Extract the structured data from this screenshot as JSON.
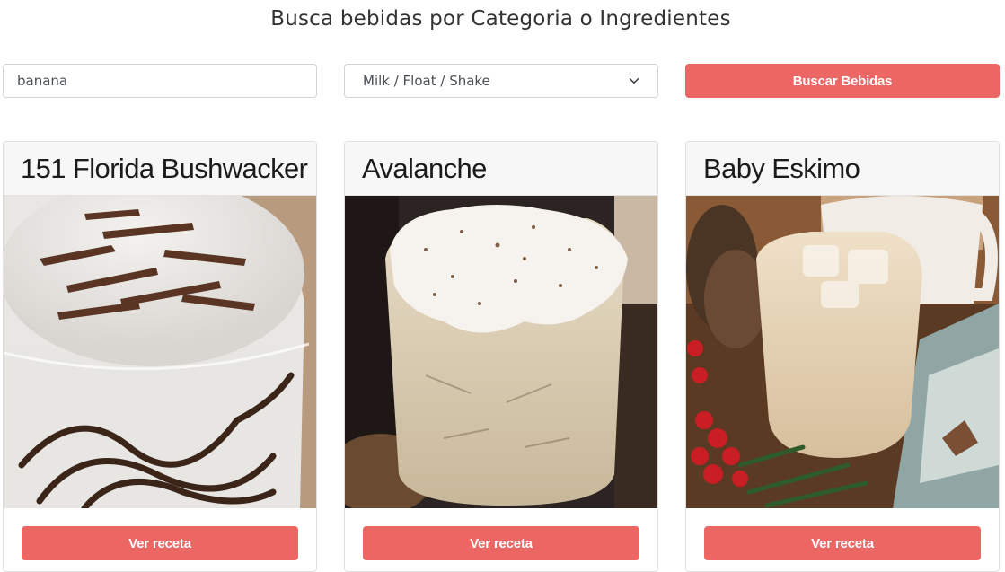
{
  "page": {
    "title": "Busca bebidas por Categoria o Ingredientes"
  },
  "search": {
    "ingredient_value": "banana",
    "category_selected": "Milk / Float / Shake",
    "button_label": "Buscar Bebidas"
  },
  "drinks": [
    {
      "name": "151 Florida Bushwacker",
      "button_label": "Ver receta"
    },
    {
      "name": "Avalanche",
      "button_label": "Ver receta"
    },
    {
      "name": "Baby Eskimo",
      "button_label": "Ver receta"
    }
  ],
  "colors": {
    "accent": "#ec6764",
    "card_header_bg": "#f7f7f7"
  }
}
